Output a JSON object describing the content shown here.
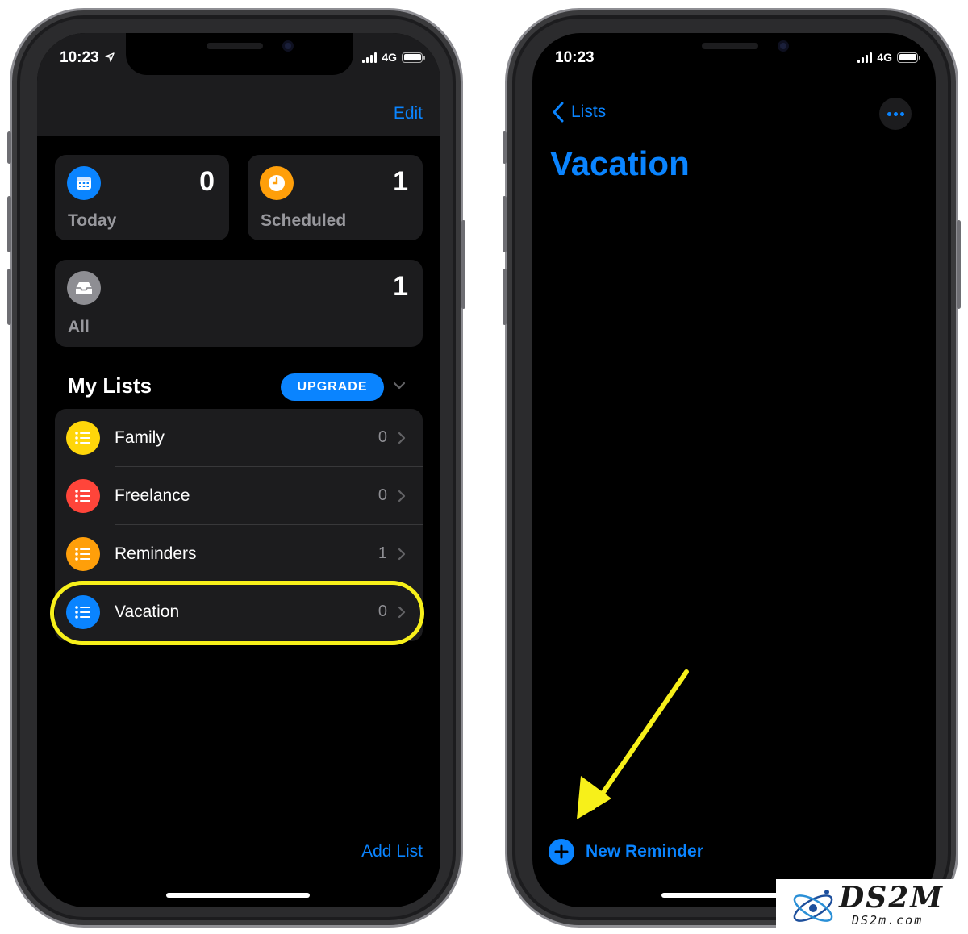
{
  "colors": {
    "accent": "#0a84ff",
    "today_icon": "#0a84ff",
    "scheduled_icon": "#ff9f0a",
    "all_icon": "#8e8e93",
    "family": "#ffd60a",
    "freelance": "#ff453a",
    "reminders": "#ff9f0a",
    "vacation": "#0a84ff",
    "highlight": "#f7f01a"
  },
  "left": {
    "status": {
      "time": "10:23",
      "network": "4G"
    },
    "nav": {
      "edit_label": "Edit"
    },
    "smart_lists": [
      {
        "label": "Today",
        "count": "0",
        "icon": "calendar-icon"
      },
      {
        "label": "Scheduled",
        "count": "1",
        "icon": "clock-icon"
      },
      {
        "label": "All",
        "count": "1",
        "icon": "tray-icon"
      }
    ],
    "my_lists": {
      "title": "My Lists",
      "upgrade_label": "UPGRADE",
      "items": [
        {
          "name": "Family",
          "count": "0",
          "icon": "list-bullet-icon"
        },
        {
          "name": "Freelance",
          "count": "0",
          "icon": "list-bullet-icon"
        },
        {
          "name": "Reminders",
          "count": "1",
          "icon": "list-bullet-icon"
        },
        {
          "name": "Vacation",
          "count": "0",
          "icon": "list-bullet-icon"
        }
      ]
    },
    "footer": {
      "add_list_label": "Add List"
    }
  },
  "right": {
    "status": {
      "time": "10:23",
      "network": "4G"
    },
    "nav": {
      "back_label": "Lists"
    },
    "list_title": "Vacation",
    "new_reminder_label": "New Reminder"
  },
  "watermark": {
    "title": "DS2M",
    "subtitle": "DS2m.com"
  }
}
